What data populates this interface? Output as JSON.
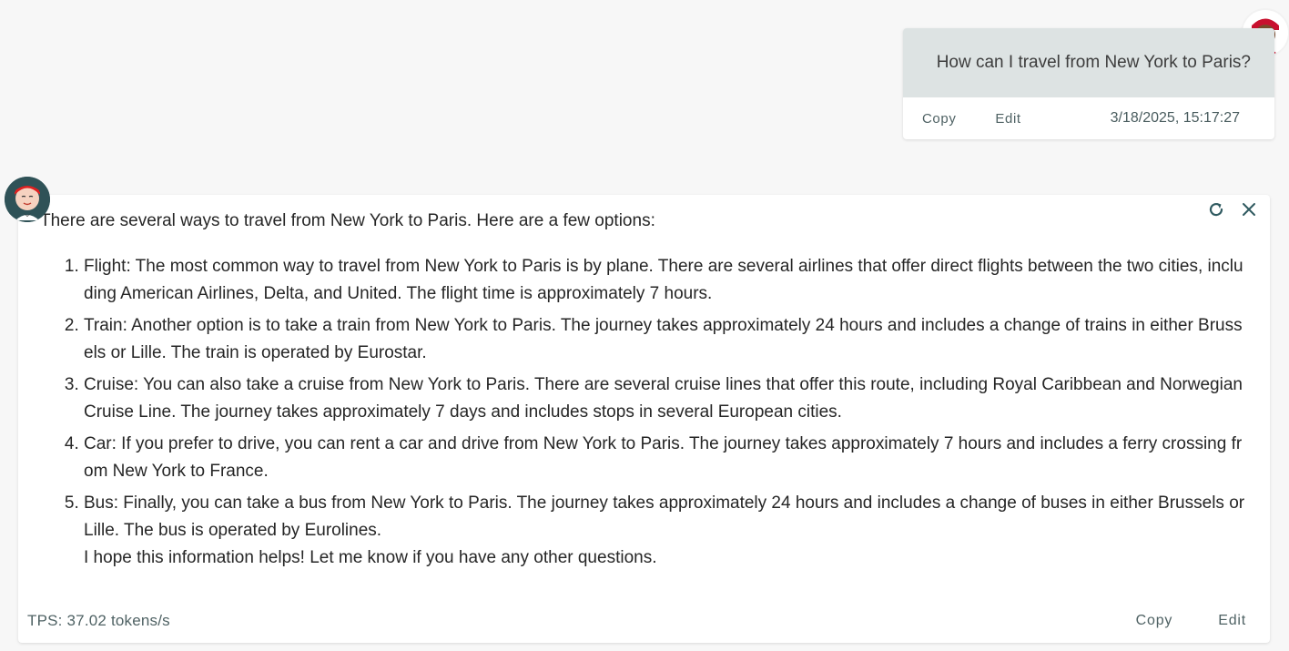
{
  "user_message": {
    "text": "How can I travel from New York to Paris?",
    "copy_label": "Copy",
    "edit_label": "Edit",
    "timestamp": "3/18/2025, 15:17:27"
  },
  "assistant_message": {
    "intro": "There are several ways to travel from New York to Paris. Here are a few options:",
    "items": [
      {
        "text": "Flight: The most common way to travel from New York to Paris is by plane. There are several airlines that offer direct flights between the two cities, including American Airlines, Delta, and United. The flight time is approximately 7 hours."
      },
      {
        "text": "Train: Another option is to take a train from New York to Paris. The journey takes approximately 24 hours and includes a change of trains in either Brussels or Lille. The train is operated by Eurostar."
      },
      {
        "text": "Cruise: You can also take a cruise from New York to Paris. There are several cruise lines that offer this route, including Royal Caribbean and Norwegian Cruise Line. The journey takes approximately 7 days and includes stops in several European cities."
      },
      {
        "text": "Car: If you prefer to drive, you can rent a car and drive from New York to Paris. The journey takes approximately 7 hours and includes a ferry crossing from New York to France."
      },
      {
        "text": "Bus: Finally, you can take a bus from New York to Paris. The journey takes approximately 24 hours and includes a change of buses in either Brussels or Lille. The bus is operated by Eurolines."
      }
    ],
    "closing": "I hope this information helps! Let me know if you have any other questions.",
    "tps": "TPS: 37.02 tokens/s",
    "copy_label": "Copy",
    "edit_label": "Edit"
  },
  "icons": {
    "regenerate": "refresh-icon",
    "close": "close-icon",
    "user_avatar": "user-avatar",
    "bot_avatar": "assistant-avatar"
  },
  "colors": {
    "user_bubble": "#dde3e3",
    "accent_text": "#4f6264",
    "icon_color": "#2f5a60"
  }
}
